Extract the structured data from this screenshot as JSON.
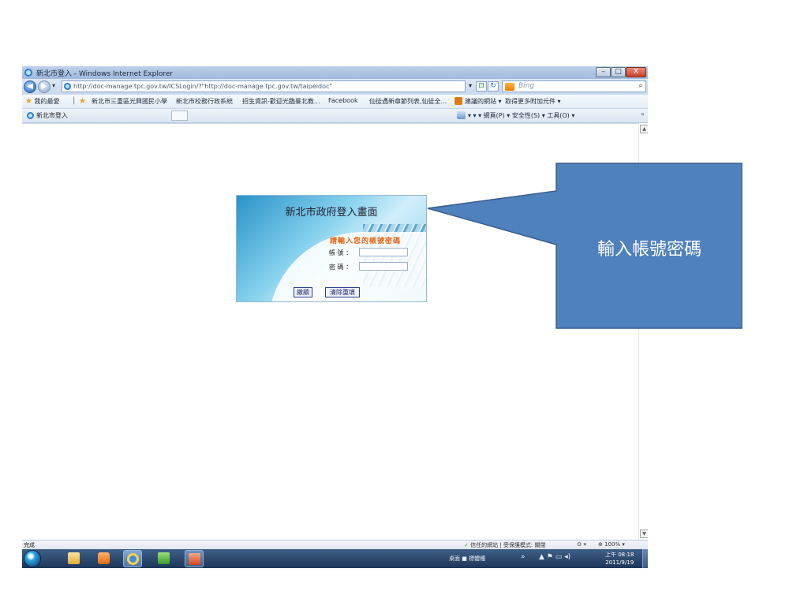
{
  "window": {
    "title": "新北市登入 - Windows Internet Explorer",
    "min_label": "–",
    "max_label": "□",
    "close_label": "X"
  },
  "address": {
    "back": "◀",
    "forward": "▶",
    "url": "http://doc-manage.tpc.gov.tw/ICSLogin/?\"http://doc-manage.tpc.gov.tw/taipeidoc\"",
    "search_placeholder": "Bing",
    "search_icon": "⌕"
  },
  "favorites": {
    "label": "我的最愛",
    "items": [
      "新北市三重區光興國民小學",
      "新北市校務行政系統",
      "招生資訊-歡迎光臨臺北教...",
      "Facebook",
      "仙徒遇新章節列表,仙徒全...",
      "建議的網站 ▾",
      "取得更多附加元件 ▾"
    ]
  },
  "tab": {
    "label": "新北市登入",
    "commands": "▾  ▾  ▾  網頁(P) ▾   安全性(S) ▾   工具(O) ▾"
  },
  "login": {
    "title": "新北市政府登入畫面",
    "prompt": "請輸入您的帳號密碼",
    "account_label": "帳  號  ：",
    "password_label": "密  碼  ：",
    "account_value": "",
    "password_value": "",
    "submit_label": "繳續",
    "reset_label": "清除重填"
  },
  "status": {
    "done": "完成",
    "zone": "信任的網站 | 受保護模式: 關閉",
    "zoom": "100%"
  },
  "taskbar": {
    "lang": "桌面  ■ 標體種",
    "chevron": "»",
    "tray_icons": "▲  ⚑  ▭  ◂)",
    "time": "上午 08:18",
    "date": "2011/9/19"
  },
  "callout": {
    "text": "輸入帳號密碼"
  },
  "colors": {
    "callout_fill": "#4f81bd",
    "callout_border": "#395e8a",
    "login_prompt": "#e56412",
    "taskbar": "#1c3659"
  }
}
